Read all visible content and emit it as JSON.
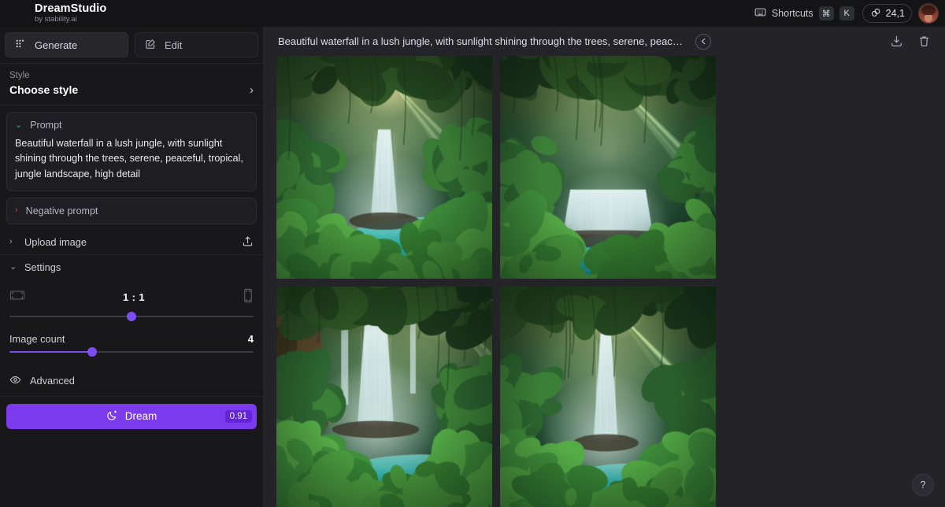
{
  "app": {
    "brand_name": "DreamStudio",
    "brand_sub": "by stability.ai"
  },
  "topbar": {
    "shortcuts_label": "Shortcuts",
    "key_cmd": "⌘",
    "key_k": "K",
    "credits": "24,1",
    "credits_icon": "credits-coin-icon",
    "shortcuts_icon": "keyboard-icon",
    "avatar_icon": "user-avatar"
  },
  "sidebar": {
    "tabs": [
      {
        "label": "Generate",
        "icon": "grid-dots-icon",
        "active": true
      },
      {
        "label": "Edit",
        "icon": "pencil-square-icon",
        "active": false
      }
    ],
    "style": {
      "label": "Style",
      "value": "Choose style",
      "chevron": "chevron-right-icon"
    },
    "prompt": {
      "header": "Prompt",
      "chevron": "chevron-down-icon",
      "text": "Beautiful waterfall in a lush jungle, with sunlight shining through the trees, serene, peaceful, tropical, jungle landscape, high detail"
    },
    "negative_prompt": {
      "header": "Negative prompt",
      "chevron": "chevron-right-icon"
    },
    "upload_image": {
      "label": "Upload image",
      "chevron": "chevron-right-icon",
      "icon": "upload-icon"
    },
    "settings": {
      "label": "Settings",
      "chevron": "chevron-down-icon",
      "aspect_ratio": {
        "value": "1 : 1",
        "left_icon": "landscape-ratio-icon",
        "right_icon": "portrait-ratio-icon",
        "slider_percent": 50
      },
      "image_count": {
        "label": "Image count",
        "value": "4",
        "slider_percent": 34
      }
    },
    "advanced": {
      "label": "Advanced",
      "icon": "eye-icon"
    },
    "dream_button": {
      "label": "Dream",
      "icon": "moon-sparkle-icon",
      "cost": "0.91"
    }
  },
  "main": {
    "title": "Beautiful waterfall in a lush jungle, with sunlight shining through the trees, serene, peaceful,...",
    "back_icon": "arrow-left-circle-icon",
    "download_icon": "download-icon",
    "delete_icon": "trash-icon",
    "help_label": "?",
    "results": [
      {
        "name": "generated-image-1",
        "variant": "tall-center-falls-sunburst"
      },
      {
        "name": "generated-image-2",
        "variant": "wide-cascade-sunbeams"
      },
      {
        "name": "generated-image-3",
        "variant": "twin-falls-left-trunk"
      },
      {
        "name": "generated-image-4",
        "variant": "narrow-tall-falls-pool"
      }
    ]
  },
  "colors": {
    "accent": "#7c3aed",
    "bg_app": "#18181b",
    "bg_main": "#232328",
    "bg_topbar": "#141417",
    "prompt_chevron": "#3ea37a",
    "negative_chevron": "#d6455e"
  }
}
